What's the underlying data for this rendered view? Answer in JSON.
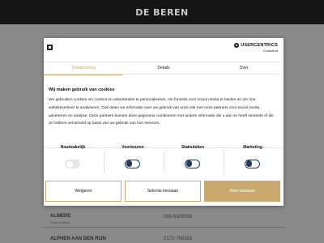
{
  "header": {
    "brand": "DE BEREN"
  },
  "background_list": [
    {
      "name": "ALMERE",
      "sub": "Stadhuisplein",
      "phone": "036-5305559"
    },
    {
      "name": "ALPHEN AAN DEN RIJN",
      "sub": "",
      "phone": "0172-766353"
    }
  ],
  "consent": {
    "provider_name": "USERCENTRICS",
    "provider_sub": "Cookiebot",
    "tabs": [
      {
        "label": "Toestemming",
        "active": true
      },
      {
        "label": "Details",
        "active": false
      },
      {
        "label": "Over",
        "active": false
      }
    ],
    "heading": "Wij maken gebruik van cookies",
    "body": "We gebruiken cookies om content en advertenties te personaliseren, om functies voor social media te bieden en om ons websiteverkeer te analyseren. Ook delen we informatie over uw gebruik van onze site met onze partners voor social media, adverteren en analyse. Deze partners kunnen deze gegevens combineren met andere informatie die u aan ze heeft verstrekt of die ze hebben verzameld op basis van uw gebruik van hun services.",
    "categories": [
      {
        "label": "Noodzakelijk",
        "state": "on-disabled"
      },
      {
        "label": "Voorkeuren",
        "state": "off"
      },
      {
        "label": "Statistieken",
        "state": "off"
      },
      {
        "label": "Marketing",
        "state": "off"
      }
    ],
    "buttons": {
      "deny": "Weigeren",
      "selection": "Selectie toestaan",
      "allow_all": "Alles toestaan"
    }
  },
  "colors": {
    "accent": "#c9a96e",
    "toggle_off": "#1f3a5a",
    "header_bg": "#151515"
  }
}
